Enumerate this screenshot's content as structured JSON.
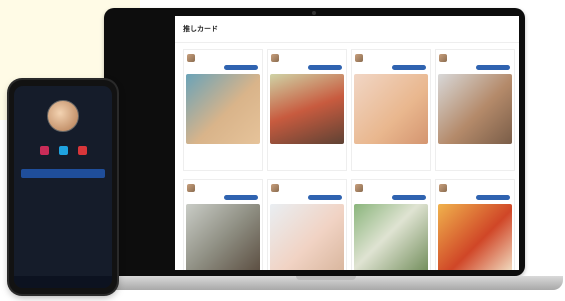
{
  "colors": {
    "accent": "#2f63b0",
    "laptop_bezel": "#0d0d0d",
    "phone_bg": "#151c2a"
  },
  "laptop": {
    "sidebar": {
      "title": "",
      "items": [
        "",
        "",
        "",
        ""
      ]
    },
    "main": {
      "title": "推しカード",
      "cards": [
        {
          "name": "",
          "follow_label": "",
          "meta1": "",
          "meta2": ""
        },
        {
          "name": "",
          "follow_label": "",
          "meta1": "",
          "meta2": ""
        },
        {
          "name": "",
          "follow_label": "",
          "meta1": "",
          "meta2": ""
        },
        {
          "name": "",
          "follow_label": "",
          "meta1": "",
          "meta2": ""
        },
        {
          "name": "",
          "follow_label": "",
          "meta1": "",
          "meta2": ""
        },
        {
          "name": "",
          "follow_label": "",
          "meta1": "",
          "meta2": ""
        },
        {
          "name": "",
          "follow_label": "",
          "meta1": "",
          "meta2": ""
        },
        {
          "name": "",
          "follow_label": "",
          "meta1": "",
          "meta2": ""
        }
      ]
    }
  },
  "phone": {
    "top": "",
    "profile_name": "",
    "stats": [
      "",
      ""
    ],
    "text1": "",
    "text2": "",
    "cta": "",
    "small": ""
  }
}
